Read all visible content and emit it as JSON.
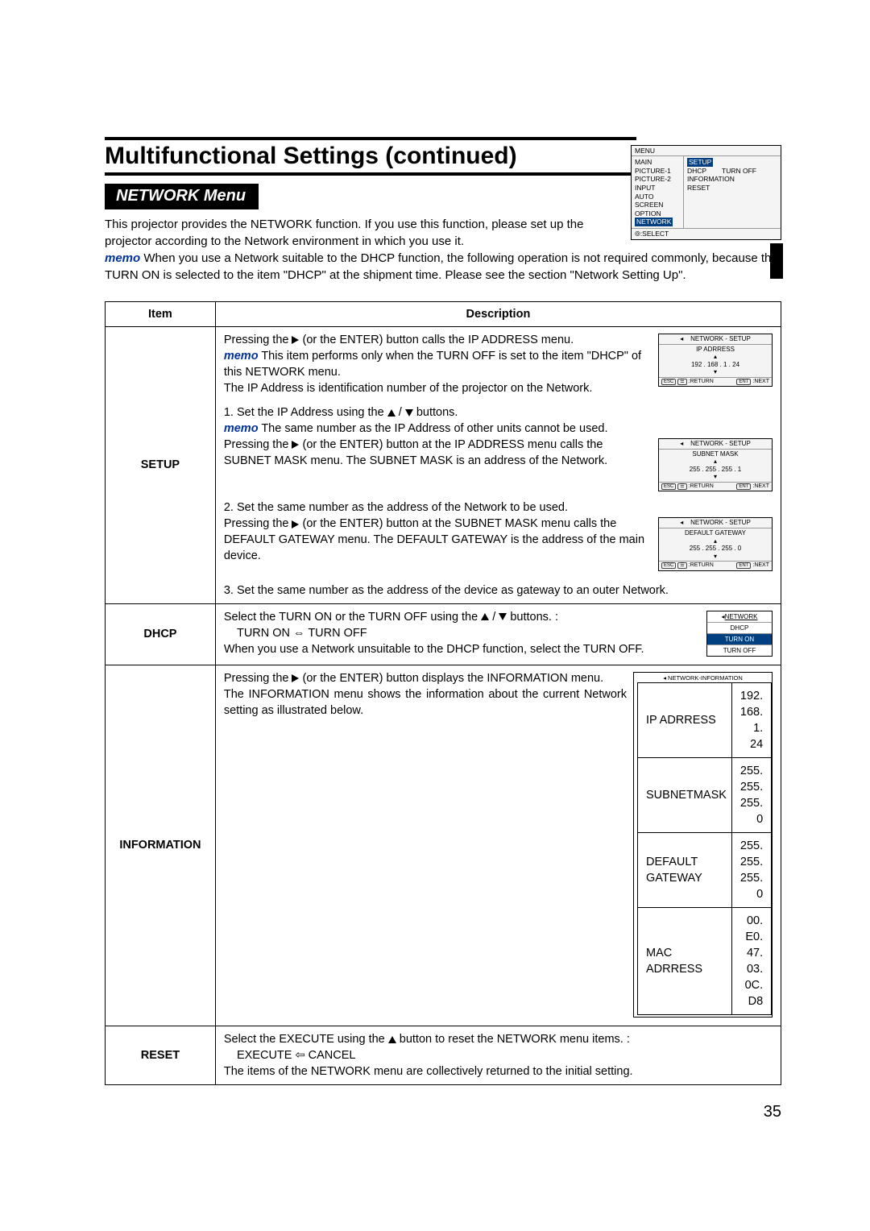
{
  "title": "Multifunctional Settings (continued)",
  "section_label": "NETWORK Menu",
  "intro_para": "This projector provides the NETWORK function. If you use this function, please set up the projector according to the Network environment in which you use it.",
  "intro_memo_label": "memo",
  "intro_memo_text": " When you use a Network suitable to the DHCP function, the following operation is not required commonly, because the TURN ON is selected to the item \"DHCP\" at the shipment time. Please see the section \"Network Setting Up\".",
  "menu": {
    "top": "MENU",
    "col1": [
      "MAIN",
      "PICTURE-1",
      "PICTURE-2",
      "INPUT",
      "AUTO",
      "SCREEN",
      "OPTION",
      "NETWORK"
    ],
    "highlight_index": 7,
    "col2_rows": [
      [
        "SETUP",
        ""
      ],
      [
        "DHCP",
        "TURN OFF"
      ],
      [
        "INFORMATION",
        ""
      ],
      [
        "RESET",
        ""
      ]
    ],
    "col2_highlight_index": 0,
    "foot": ":SELECT",
    "foot_icon": "⦾"
  },
  "table": {
    "head_item": "Item",
    "head_desc": "Description",
    "rows": {
      "setup": {
        "label": "SETUP",
        "p1a": "Pressing the ",
        "p1b": " (or the ENTER) button calls the IP ADDRESS menu.",
        "p1_memo_label": "memo",
        "p1_memo": " This item performs only when the TURN OFF is set to the item \"DHCP\" of this NETWORK menu.",
        "p1c": "The IP Address is identification number of the projector on the Network.",
        "step1a": "1. Set the IP Address using the ",
        "step1b": " / ",
        "step1c": " buttons.",
        "step1_memo_label": "memo",
        "step1_memo": " The same number as the IP Address of other units cannot be used.",
        "step1_p2a": "Pressing the ",
        "step1_p2b": " (or the ENTER) button at the IP ADDRESS menu calls the SUBNET MASK menu. The SUBNET MASK is an address of the Network.",
        "step2_t": "2. Set the same number as the address of the Network to be used.",
        "step2_pa": "Pressing the ",
        "step2_pb": " (or the ENTER) button at the SUBNET MASK menu calls the DEFAULT GATEWAY menu. The DEFAULT GATEWAY is the address of the main device.",
        "step3": "3. Set the same number as the address of the device as gateway to an outer Network.",
        "inset1_title": "NETWORK - SETUP",
        "inset1_row": "IP ADRRESS",
        "inset1_val": "192 . 168 .  1 .  24",
        "inset2_title": "NETWORK - SETUP",
        "inset2_row": "SUBNET MASK",
        "inset2_val": "255 . 255 . 255 .   1",
        "inset3_title": "NETWORK - SETUP",
        "inset3_row": "DEFAULT GATEWAY",
        "inset3_val": "255 . 255 . 255 .   0",
        "inset_foot_left": ":RETURN",
        "inset_foot_right": ":NEXT",
        "kbd_esc": "ESC",
        "kbd_menu": "☰",
        "kbd_ent": "ENT"
      },
      "dhcp": {
        "label": "DHCP",
        "p1a": "Select the TURN ON or the TURN OFF using the ",
        "p1b": " / ",
        "p1c": " buttons. :",
        "toggle": "TURN ON ⇔ TURN OFF",
        "p2": "When you use a Network unsuitable to the DHCP function, select the TURN OFF.",
        "box_title_pre": "◂",
        "box_title": "NETWORK",
        "box_row1": "DHCP",
        "box_on": "TURN ON",
        "box_off": "TURN OFF"
      },
      "information": {
        "label": "INFORMATION",
        "p1a": "Pressing the ",
        "p1b": " (or the ENTER) button displays the INFORMATION menu.",
        "p2": "The INFORMATION menu shows the information about the current Network setting as illustrated below.",
        "box_title": "◂ NETWORK-INFORMATION",
        "rows": [
          [
            "IP ADRRESS",
            "192. 168. 1. 24"
          ],
          [
            "SUBNETMASK",
            "255. 255. 255. 0"
          ],
          [
            "DEFAULT GATEWAY",
            "255. 255. 255. 0"
          ],
          [
            "MAC ADRRESS",
            "00. E0. 47. 03. 0C. D8"
          ]
        ]
      },
      "reset": {
        "label": "RESET",
        "p1a": "Select the EXECUTE using the ",
        "p1b": " button to reset the NETWORK menu items. :",
        "toggle": "EXECUTE ⇦ CANCEL",
        "p2": "The items of the NETWORK menu are collectively returned to the initial setting."
      }
    }
  },
  "page_number": "35"
}
